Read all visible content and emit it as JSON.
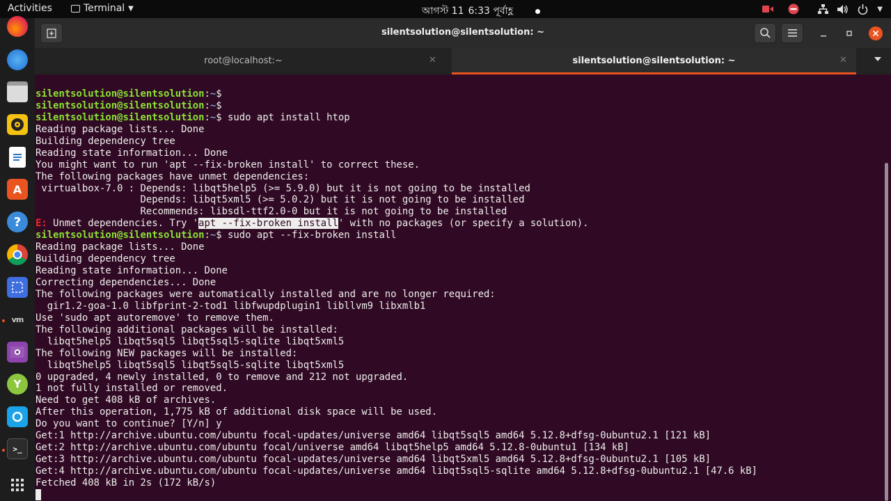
{
  "topbar": {
    "activities": "Activities",
    "app_name": "Terminal",
    "date": "আগস্ট 11",
    "time": "6:33 পূর্বাহ্ণ"
  },
  "window": {
    "title": "silentsolution@silentsolution: ~"
  },
  "tabs": [
    {
      "label": "root@localhost:~",
      "active": false
    },
    {
      "label": "silentsolution@silentsolution: ~",
      "active": true
    }
  ],
  "colors": {
    "terminal_bg": "#300a24",
    "prompt_user": "#8ae234",
    "prompt_path": "#729fcf",
    "accent": "#e95420",
    "error": "#ef2929"
  },
  "terminal": {
    "prompt_user": "silentsolution@silentsolution",
    "prompt_path": "~",
    "commands": [
      "",
      "",
      "sudo apt install htop",
      "sudo apt --fix-broken install"
    ],
    "output1": [
      "Reading package lists... Done",
      "Building dependency tree",
      "Reading state information... Done",
      "You might want to run 'apt --fix-broken install' to correct these.",
      "The following packages have unmet dependencies:",
      " virtualbox-7.0 : Depends: libqt5help5 (>= 5.9.0) but it is not going to be installed",
      "                  Depends: libqt5xml5 (>= 5.0.2) but it is not going to be installed",
      "                  Recommends: libsdl-ttf2.0-0 but it is not going to be installed"
    ],
    "error_line": {
      "prefix": "E:",
      "before": " Unmet dependencies. Try '",
      "selected": "apt --fix-broken install",
      "after": "' with no packages (or specify a solution)."
    },
    "output2": [
      "Reading package lists... Done",
      "Building dependency tree",
      "Reading state information... Done",
      "Correcting dependencies... Done",
      "The following packages were automatically installed and are no longer required:",
      "  gir1.2-goa-1.0 libfprint-2-tod1 libfwupdplugin1 libllvm9 libxmlb1",
      "Use 'sudo apt autoremove' to remove them.",
      "The following additional packages will be installed:",
      "  libqt5help5 libqt5sql5 libqt5sql5-sqlite libqt5xml5",
      "The following NEW packages will be installed:",
      "  libqt5help5 libqt5sql5 libqt5sql5-sqlite libqt5xml5",
      "0 upgraded, 4 newly installed, 0 to remove and 212 not upgraded.",
      "1 not fully installed or removed.",
      "Need to get 408 kB of archives.",
      "After this operation, 1,775 kB of additional disk space will be used.",
      "Do you want to continue? [Y/n] y",
      "Get:1 http://archive.ubuntu.com/ubuntu focal-updates/universe amd64 libqt5sql5 amd64 5.12.8+dfsg-0ubuntu2.1 [121 kB]",
      "Get:2 http://archive.ubuntu.com/ubuntu focal/universe amd64 libqt5help5 amd64 5.12.8-0ubuntu1 [134 kB]",
      "Get:3 http://archive.ubuntu.com/ubuntu focal-updates/universe amd64 libqt5xml5 amd64 5.12.8+dfsg-0ubuntu2.1 [105 kB]",
      "Get:4 http://archive.ubuntu.com/ubuntu focal-updates/universe amd64 libqt5sql5-sqlite amd64 5.12.8+dfsg-0ubuntu2.1 [47.6 kB]",
      "Fetched 408 kB in 2s (172 kB/s)"
    ]
  }
}
